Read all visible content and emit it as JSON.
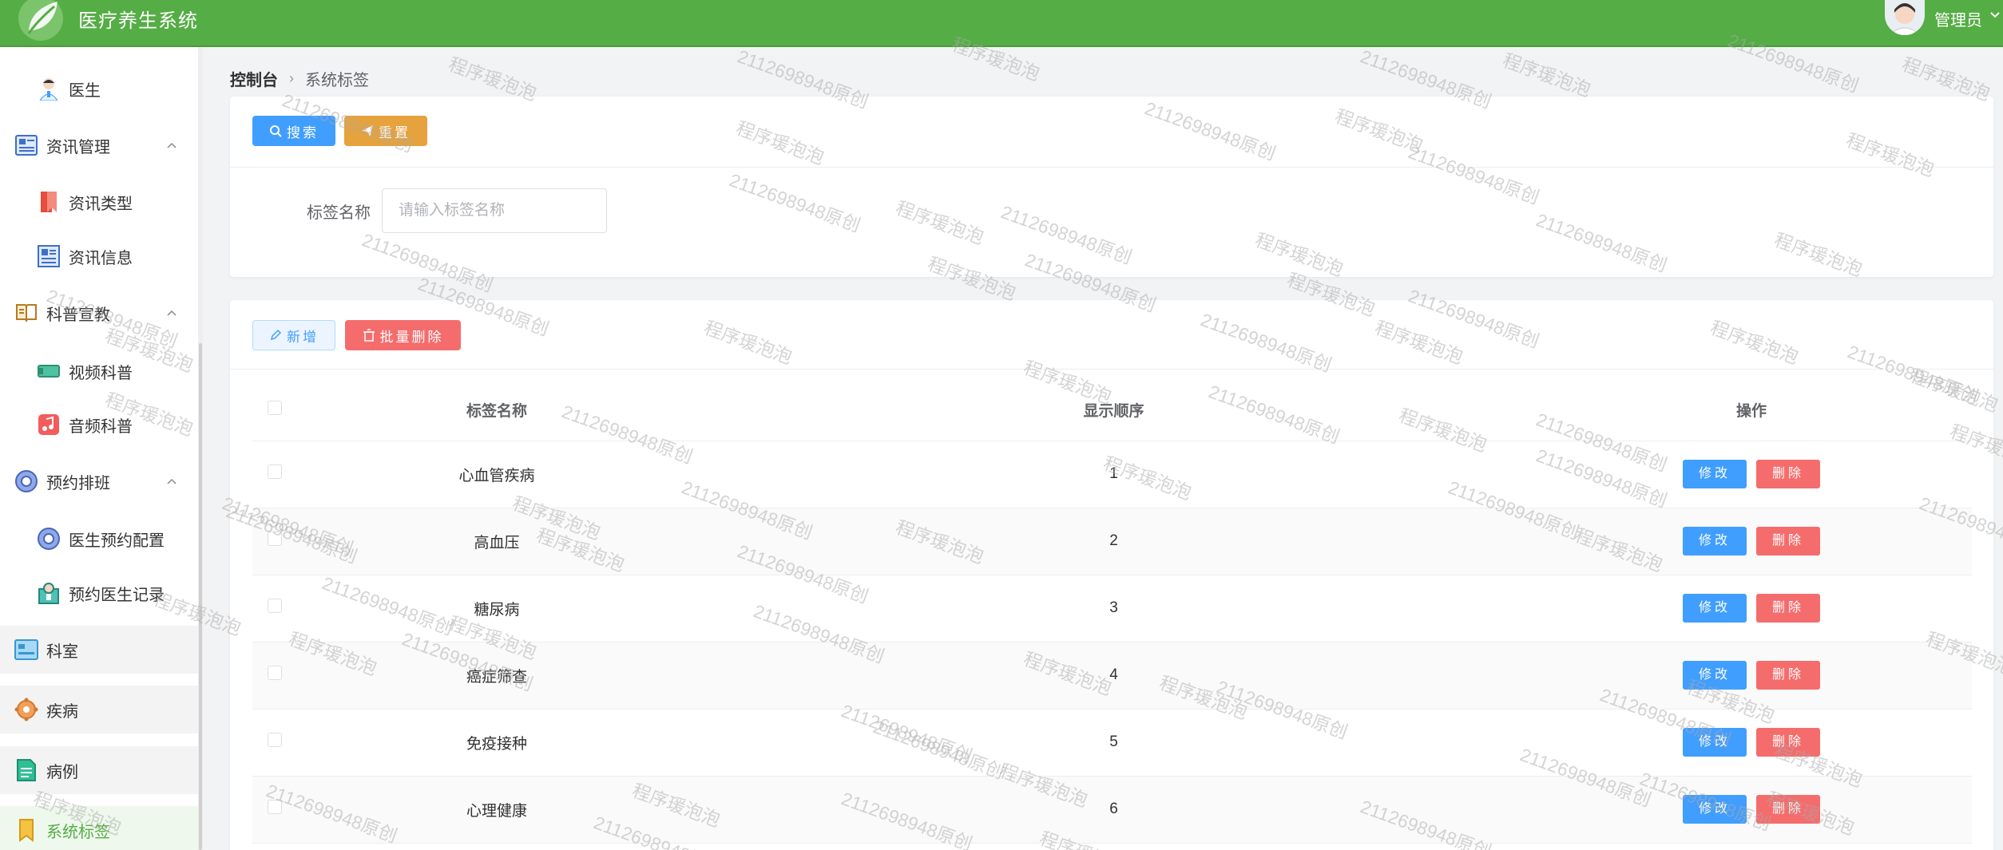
{
  "header": {
    "app_title": "医疗养生系统",
    "user_name": "管理员"
  },
  "sidebar": {
    "items": [
      {
        "label": "医生",
        "level": "sub",
        "icon": "doctor-icon"
      },
      {
        "label": "资讯管理",
        "level": "top",
        "icon": "news-icon",
        "expanded": true
      },
      {
        "label": "资讯类型",
        "level": "sub",
        "icon": "bookmark-icon"
      },
      {
        "label": "资讯信息",
        "level": "sub",
        "icon": "newspaper-icon"
      },
      {
        "label": "科普宣教",
        "level": "top",
        "icon": "book-icon",
        "expanded": true
      },
      {
        "label": "视频科普",
        "level": "sub",
        "icon": "video-icon"
      },
      {
        "label": "音频科普",
        "level": "sub",
        "icon": "music-icon"
      },
      {
        "label": "预约排班",
        "level": "top",
        "icon": "schedule-icon",
        "expanded": true
      },
      {
        "label": "医生预约配置",
        "level": "sub",
        "icon": "gear-icon"
      },
      {
        "label": "预约医生记录",
        "level": "sub",
        "icon": "record-icon"
      },
      {
        "label": "科室",
        "level": "top",
        "icon": "department-icon"
      },
      {
        "label": "疾病",
        "level": "top",
        "icon": "disease-icon"
      },
      {
        "label": "病例",
        "level": "top",
        "icon": "case-icon"
      },
      {
        "label": "系统标签",
        "level": "top",
        "icon": "tag-icon",
        "active": true
      }
    ]
  },
  "breadcrumb": {
    "home": "控制台",
    "current": "系统标签"
  },
  "search": {
    "search_button": "搜索",
    "reset_button": "重置",
    "field_label": "标签名称",
    "field_value": "",
    "field_placeholder": "请输入标签名称"
  },
  "toolbar": {
    "add_button": "新增",
    "batch_delete_button": "批量删除"
  },
  "table": {
    "columns": [
      "标签名称",
      "显示顺序",
      "操作"
    ],
    "rows": [
      {
        "name": "心血管疾病",
        "order": "1"
      },
      {
        "name": "高血压",
        "order": "2"
      },
      {
        "name": "糖尿病",
        "order": "3"
      },
      {
        "name": "癌症筛查",
        "order": "4"
      },
      {
        "name": "免疫接种",
        "order": "5"
      },
      {
        "name": "心理健康",
        "order": "6"
      }
    ],
    "edit_label": "修改",
    "delete_label": "删除"
  },
  "watermark": {
    "texts": [
      "程序瑗泡泡",
      "2112698948原创"
    ]
  },
  "colors": {
    "header_green": "#55ad45",
    "primary_blue": "#409eff",
    "warning_orange": "#e6a23c",
    "danger_red": "#f56c6c"
  }
}
